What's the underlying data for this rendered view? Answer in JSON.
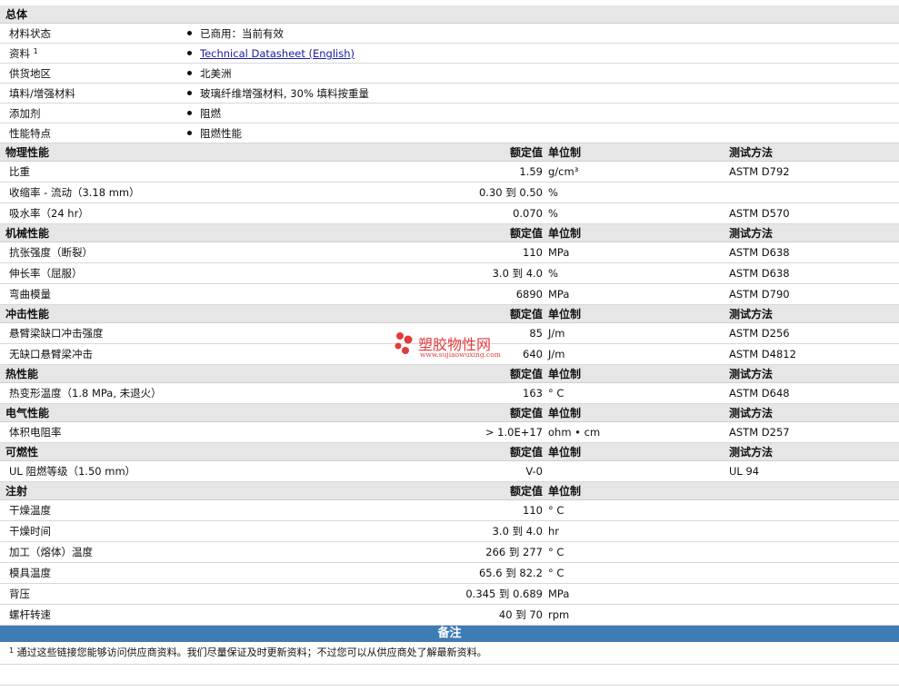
{
  "general": {
    "title": "总体",
    "rows": [
      {
        "name": "材料状态",
        "value": "已商用：当前有效"
      },
      {
        "name": "资料",
        "sup": "1",
        "value": "Technical Datasheet (English)",
        "link": true
      },
      {
        "name": "供货地区",
        "value": "北美洲"
      },
      {
        "name": "填料/增强材料",
        "value": "玻璃纤维增强材料, 30% 填料按重量"
      },
      {
        "name": "添加剂",
        "value": "阻燃"
      },
      {
        "name": "性能特点",
        "value": "阻燃性能"
      }
    ]
  },
  "columns": {
    "nominal": "额定值",
    "unit": "单位制",
    "method": "测试方法"
  },
  "sections": [
    {
      "title": "物理性能",
      "show_method": true,
      "rows": [
        {
          "name": "比重",
          "value": "1.59",
          "unit": "g/cm³",
          "method": "ASTM D792"
        },
        {
          "name": "收缩率 - 流动（3.18 mm）",
          "value": "0.30 到  0.50",
          "unit": "%",
          "method": ""
        },
        {
          "name": "吸水率（24 hr）",
          "value": "0.070",
          "unit": "%",
          "method": "ASTM D570"
        }
      ]
    },
    {
      "title": "机械性能",
      "show_method": true,
      "rows": [
        {
          "name": "抗张强度（断裂）",
          "value": "110",
          "unit": "MPa",
          "method": "ASTM D638"
        },
        {
          "name": "伸长率（屈服）",
          "value": "3.0 到  4.0",
          "unit": "%",
          "method": "ASTM D638"
        },
        {
          "name": "弯曲模量",
          "value": "6890",
          "unit": "MPa",
          "method": "ASTM D790"
        }
      ]
    },
    {
      "title": "冲击性能",
      "show_method": true,
      "rows": [
        {
          "name": "悬臂梁缺口冲击强度",
          "value": "85",
          "unit": "J/m",
          "method": "ASTM D256"
        },
        {
          "name": "无缺口悬臂梁冲击",
          "value": "640",
          "unit": "J/m",
          "method": "ASTM D4812"
        }
      ]
    },
    {
      "title": "热性能",
      "show_method": true,
      "rows": [
        {
          "name": "热变形温度（1.8 MPa, 未退火）",
          "value": "163",
          "unit": "°  C",
          "method": "ASTM D648"
        }
      ]
    },
    {
      "title": "电气性能",
      "show_method": true,
      "rows": [
        {
          "name": "体积电阻率",
          "value": "> 1.0E+17",
          "unit": "ohm • cm",
          "method": "ASTM D257"
        }
      ]
    },
    {
      "title": "可燃性",
      "show_method": true,
      "rows": [
        {
          "name": "UL 阻燃等级（1.50 mm）",
          "value": "V-0",
          "unit": "",
          "method": "UL 94"
        }
      ]
    },
    {
      "title": "注射",
      "show_method": false,
      "rows": [
        {
          "name": "干燥温度",
          "value": "110",
          "unit": "°  C",
          "method": ""
        },
        {
          "name": "干燥时间",
          "value": "3.0 到  4.0",
          "unit": "hr",
          "method": ""
        },
        {
          "name": "加工（熔体）温度",
          "value": "266 到  277",
          "unit": "°  C",
          "method": ""
        },
        {
          "name": "模具温度",
          "value": "65.6 到  82.2",
          "unit": "°  C",
          "method": ""
        },
        {
          "name": "背压",
          "value": "0.345 到  0.689",
          "unit": "MPa",
          "method": ""
        },
        {
          "name": "螺杆转速",
          "value": "40 到  70",
          "unit": "rpm",
          "method": ""
        }
      ]
    }
  ],
  "notes": {
    "title": "备注",
    "items": [
      {
        "sup": "1",
        "text": "通过这些链接您能够访问供应商资料。我们尽量保证及时更新资料；不过您可以从供应商处了解最新资料。"
      }
    ]
  },
  "watermark": {
    "text": "塑胶物性网",
    "url": "www.sujiaowuxing.com",
    "color": "#e23b3b"
  }
}
